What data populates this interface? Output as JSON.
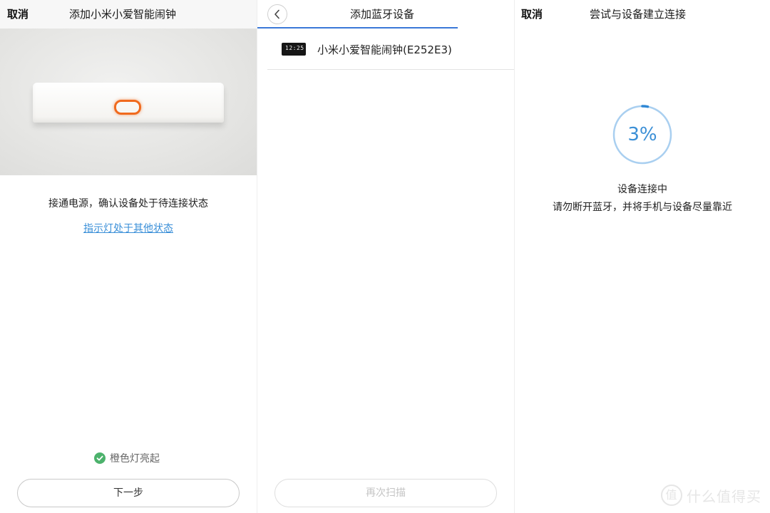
{
  "panel1": {
    "cancel_label": "取消",
    "title": "添加小米小爱智能闹钟",
    "instruction": "接通电源，确认设备处于待连接状态",
    "help_link": "指示灯处于其他状态",
    "confirm_label": "橙色灯亮起",
    "next_button": "下一步"
  },
  "panel2": {
    "title": "添加蓝牙设备",
    "device": {
      "name": "小米小爱智能闹钟(E252E3)",
      "clock_display": "12:25"
    },
    "rescan_button": "再次扫描"
  },
  "panel3": {
    "cancel_label": "取消",
    "title": "尝试与设备建立连接",
    "progress_label": "3%",
    "progress_value": 0.03,
    "status_line1": "设备连接中",
    "status_line2": "请勿断开蓝牙，并将手机与设备尽量靠近"
  },
  "watermark": {
    "icon_char": "值",
    "text": "什么值得买"
  },
  "colors": {
    "accent": "#3b78d8",
    "link": "#3a8fd8",
    "progress": "#3b8fd6",
    "check": "#4cb26c",
    "led": "#f06a1e"
  }
}
